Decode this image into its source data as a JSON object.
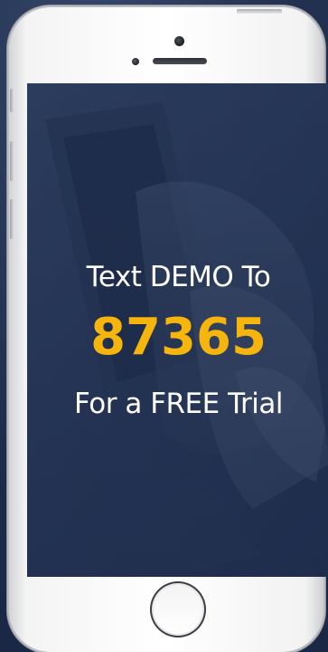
{
  "promo": {
    "line1": "Text DEMO To",
    "code": "87365",
    "line2": "For a FREE Trial"
  },
  "colors": {
    "background": "#1c2a47",
    "screen_tint": "#243454",
    "accent_code": "#f5b50d",
    "text": "#ffffff",
    "phone_body": "#f4f4f4"
  },
  "icons": [
    "camera-icon",
    "speaker-icon",
    "home-button-icon"
  ]
}
